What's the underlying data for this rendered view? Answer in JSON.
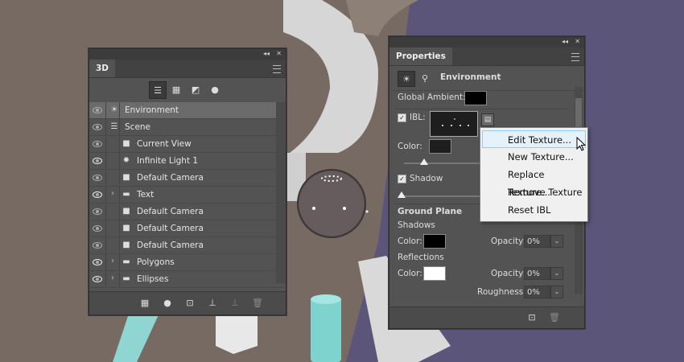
{
  "panel3d": {
    "title": "3D",
    "toolbar_icons": [
      "scene-list-icon",
      "mesh-icon",
      "material-icon",
      "light-icon"
    ],
    "rows": [
      {
        "label": "Environment",
        "icon": "environment-icon",
        "indent": 0,
        "selected": true,
        "expandable": false,
        "eye": "dim"
      },
      {
        "label": "Scene",
        "icon": "scene-icon",
        "indent": 0,
        "selected": false,
        "expandable": false,
        "eye": "dim"
      },
      {
        "label": "Current View",
        "icon": "camera-icon",
        "indent": 1,
        "selected": false,
        "expandable": false,
        "eye": "dim"
      },
      {
        "label": "Infinite Light 1",
        "icon": "infinite-light-icon",
        "indent": 1,
        "selected": false,
        "expandable": false,
        "eye": "on"
      },
      {
        "label": "Default Camera",
        "icon": "camera-icon",
        "indent": 1,
        "selected": false,
        "expandable": false,
        "eye": "dim"
      },
      {
        "label": "Text",
        "icon": "folder-icon",
        "indent": 1,
        "selected": false,
        "expandable": true,
        "eye": "on"
      },
      {
        "label": "Default Camera",
        "icon": "camera-icon",
        "indent": 1,
        "selected": false,
        "expandable": false,
        "eye": "dim"
      },
      {
        "label": "Default Camera",
        "icon": "camera-icon",
        "indent": 1,
        "selected": false,
        "expandable": false,
        "eye": "dim"
      },
      {
        "label": "Default Camera",
        "icon": "camera-icon",
        "indent": 1,
        "selected": false,
        "expandable": false,
        "eye": "dim"
      },
      {
        "label": "Polygons",
        "icon": "folder-icon",
        "indent": 1,
        "selected": false,
        "expandable": true,
        "eye": "on"
      },
      {
        "label": "Ellipses",
        "icon": "folder-icon",
        "indent": 1,
        "selected": false,
        "expandable": true,
        "eye": "on"
      }
    ],
    "bottom_icons": [
      "new-mesh-icon",
      "new-light-icon",
      "render-icon",
      "drop-to-plane-icon",
      "constraint-icon",
      "trash-icon"
    ]
  },
  "properties": {
    "title": "Properties",
    "section_title": "Environment",
    "global_ambient_label": "Global Ambient:",
    "ibl_label": "IBL:",
    "ibl_checked": true,
    "color_label": "Color:",
    "shadow_label": "Shadow",
    "shadow_checked": true,
    "ground_plane_label": "Ground Plane",
    "shadows_label": "Shadows",
    "shadows_color_label": "Color:",
    "shadows_opacity_label": "Opacity:",
    "shadows_opacity_value": "0%",
    "reflections_label": "Reflections",
    "reflections_color_label": "Color:",
    "reflections_opacity_label": "Opacity:",
    "reflections_opacity_value": "0%",
    "roughness_label": "Roughness:",
    "roughness_value": "0%",
    "colors": {
      "global_ambient": "#000000",
      "ibl_color": "#1e1e1e",
      "shadows_color": "#000000",
      "reflections_color": "#ffffff"
    }
  },
  "context_menu": {
    "items": [
      "Edit Texture...",
      "New Texture...",
      "Replace Texture...",
      "Remove Texture",
      "Reset IBL"
    ],
    "hovered_index": 0
  }
}
